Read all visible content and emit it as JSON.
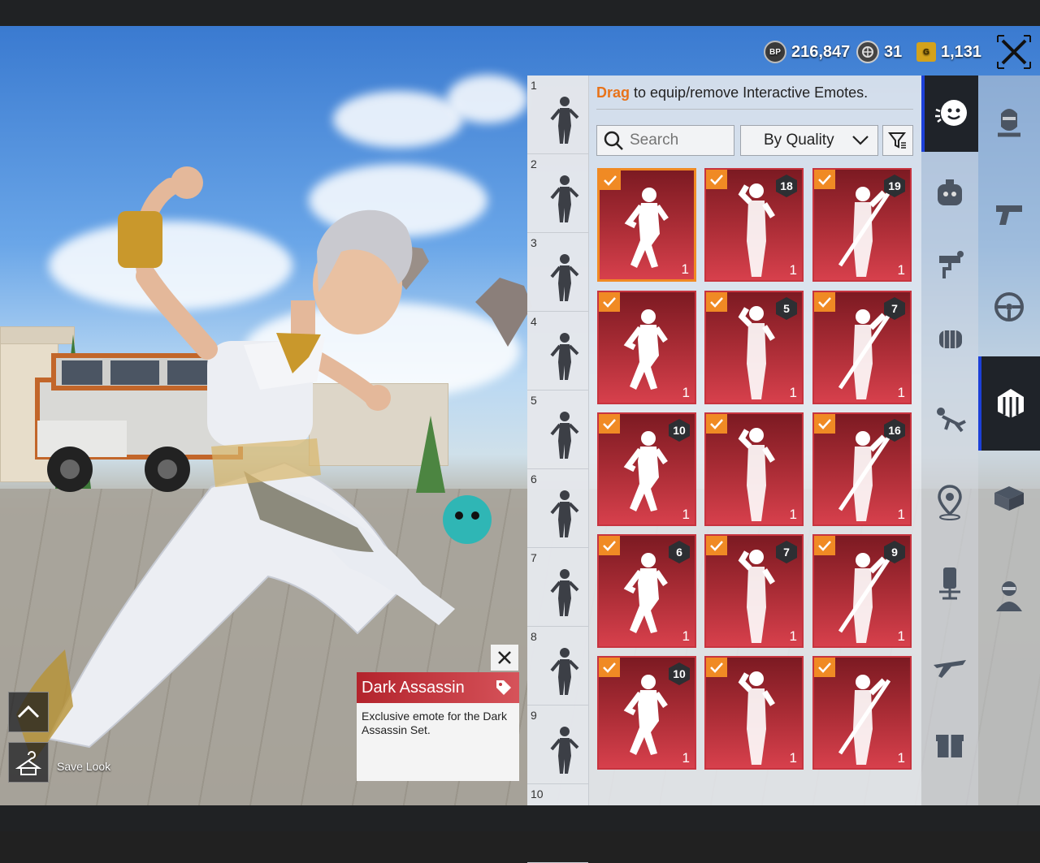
{
  "currency": [
    {
      "icon": "bp-coin-icon",
      "code": "BP",
      "value": "216,847"
    },
    {
      "icon": "silver-fragment-icon",
      "code": "",
      "value": "31"
    },
    {
      "icon": "gold-g-coin-icon",
      "code": "G",
      "value": "1,131"
    }
  ],
  "hint": {
    "highlight": "Drag",
    "rest": " to equip/remove Interactive Emotes."
  },
  "search": {
    "placeholder": "Search"
  },
  "sort": {
    "label": "By Quality"
  },
  "slots": [
    "1",
    "2",
    "3",
    "4",
    "5",
    "6",
    "7",
    "8",
    "9",
    "10"
  ],
  "cards": [
    {
      "checked": true,
      "level": "",
      "qty": "1",
      "selected": true
    },
    {
      "checked": true,
      "level": "18",
      "qty": "1"
    },
    {
      "checked": true,
      "level": "19",
      "qty": "1"
    },
    {
      "checked": true,
      "level": "",
      "qty": "1"
    },
    {
      "checked": true,
      "level": "5",
      "qty": "1"
    },
    {
      "checked": true,
      "level": "7",
      "qty": "1"
    },
    {
      "checked": true,
      "level": "10",
      "qty": "1"
    },
    {
      "checked": true,
      "level": "",
      "qty": "1"
    },
    {
      "checked": true,
      "level": "16",
      "qty": "1"
    },
    {
      "checked": true,
      "level": "6",
      "qty": "1"
    },
    {
      "checked": true,
      "level": "7",
      "qty": "1"
    },
    {
      "checked": true,
      "level": "9",
      "qty": "1"
    },
    {
      "checked": true,
      "level": "10",
      "qty": "1"
    },
    {
      "checked": true,
      "level": "",
      "qty": "1"
    },
    {
      "checked": true,
      "level": "",
      "qty": "1"
    }
  ],
  "tooltip": {
    "title": "Dark Assassin",
    "description": "Exclusive emote for the Dark Assassin Set."
  },
  "save_look": "Save Look",
  "colors": {
    "accent": "#f08a24",
    "card": "#a52a33",
    "active_tab": "#1c40d8"
  }
}
